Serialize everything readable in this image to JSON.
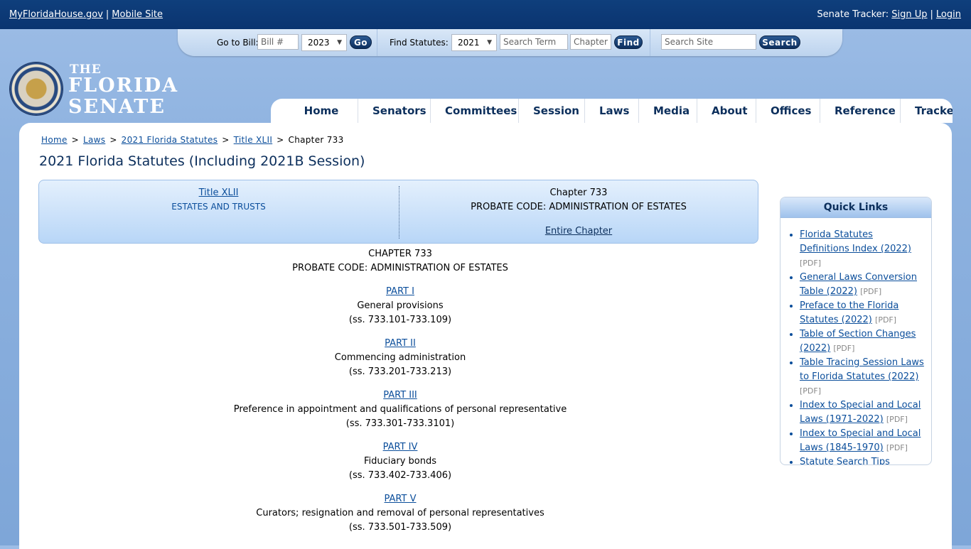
{
  "topbar": {
    "house_link": "MyFloridaHouse.gov",
    "separator": "|",
    "mobile_link": "Mobile Site",
    "tracker_label": "Senate Tracker:",
    "signup_link": "Sign Up",
    "login_link": "Login"
  },
  "search": {
    "goto_label": "Go to Bill:",
    "bill_placeholder": "Bill #",
    "bill_year": "2023",
    "go_button": "Go",
    "find_label": "Find Statutes:",
    "statute_year": "2021",
    "term_placeholder": "Search Term",
    "chapter_placeholder": "Chapter",
    "find_button": "Find",
    "site_placeholder": "Search Site",
    "search_button": "Search"
  },
  "logo": {
    "the": "THE",
    "florida": "FLORIDA",
    "senate": "SENATE"
  },
  "nav": {
    "items": [
      "Home",
      "Senators",
      "Committees",
      "Session",
      "Laws",
      "Media",
      "About",
      "Offices",
      "Reference",
      "Tracker"
    ]
  },
  "breadcrumb": {
    "home": "Home",
    "laws": "Laws",
    "statutes": "2021 Florida Statutes",
    "title": "Title XLII",
    "current": "Chapter 733",
    "sep": ">"
  },
  "page_title": "2021 Florida Statutes (Including 2021B Session)",
  "chapter_box": {
    "title_link": "Title XLII",
    "title_name": "ESTATES AND TRUSTS",
    "chapter_num": "Chapter 733",
    "chapter_desc": "PROBATE CODE: ADMINISTRATION OF ESTATES",
    "entire_chapter": "Entire Chapter"
  },
  "chapter": {
    "heading": "CHAPTER 733",
    "subheading": "PROBATE CODE: ADMINISTRATION OF ESTATES",
    "parts": [
      {
        "label": "PART I",
        "desc": "General provisions",
        "range": "(ss. 733.101-733.109)"
      },
      {
        "label": "PART II",
        "desc": "Commencing administration",
        "range": "(ss. 733.201-733.213)"
      },
      {
        "label": "PART III",
        "desc": "Preference in appointment and qualifications of personal representative",
        "range": "(ss. 733.301-733.3101)"
      },
      {
        "label": "PART IV",
        "desc": "Fiduciary bonds",
        "range": "(ss. 733.402-733.406)"
      },
      {
        "label": "PART V",
        "desc": "Curators; resignation and removal of personal representatives",
        "range": "(ss. 733.501-733.509)"
      }
    ]
  },
  "quick_links": {
    "heading": "Quick Links",
    "items": [
      {
        "text": "Florida Statutes Definitions Index (2022)",
        "tag": "[PDF]"
      },
      {
        "text": "General Laws Conversion Table (2022)",
        "tag": "[PDF]"
      },
      {
        "text": "Preface to the Florida Statutes (2022)",
        "tag": "[PDF]"
      },
      {
        "text": "Table of Section Changes (2022)",
        "tag": "[PDF]"
      },
      {
        "text": "Table Tracing Session Laws to Florida Statutes (2022)",
        "tag": "[PDF]"
      },
      {
        "text": "Index to Special and Local Laws (1971-2022)",
        "tag": "[PDF]"
      },
      {
        "text": "Index to Special and Local Laws (1845-1970)",
        "tag": "[PDF]"
      },
      {
        "text": "Statute Search Tips",
        "tag": ""
      }
    ]
  }
}
